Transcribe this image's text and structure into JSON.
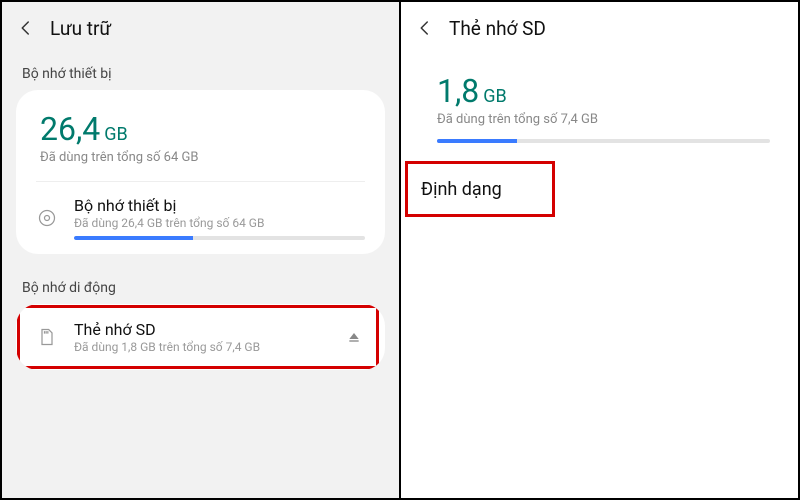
{
  "left": {
    "title": "Lưu trữ",
    "section_device": "Bộ nhớ thiết bị",
    "hero_value": "26,4",
    "hero_unit": "GB",
    "hero_sub": "Đã dùng trên tổng số 64 GB",
    "device_row": {
      "title": "Bộ nhớ thiết bị",
      "sub": "Đã dùng 26,4 GB trên tổng số 64 GB",
      "progress_pct": 41
    },
    "section_portable": "Bộ nhớ di động",
    "sd_row": {
      "title": "Thẻ nhớ SD",
      "sub": "Đã dùng 1,8 GB trên tổng số 7,4 GB"
    }
  },
  "right": {
    "title": "Thẻ nhớ SD",
    "hero_value": "1,8",
    "hero_unit": "GB",
    "hero_sub": "Đã dùng trên tổng số 7,4 GB",
    "progress_pct": 24,
    "format_label": "Định dạng"
  },
  "colors": {
    "accent_teal": "#007a6c",
    "progress_blue": "#3a7bff",
    "highlight_red": "#d40000"
  }
}
